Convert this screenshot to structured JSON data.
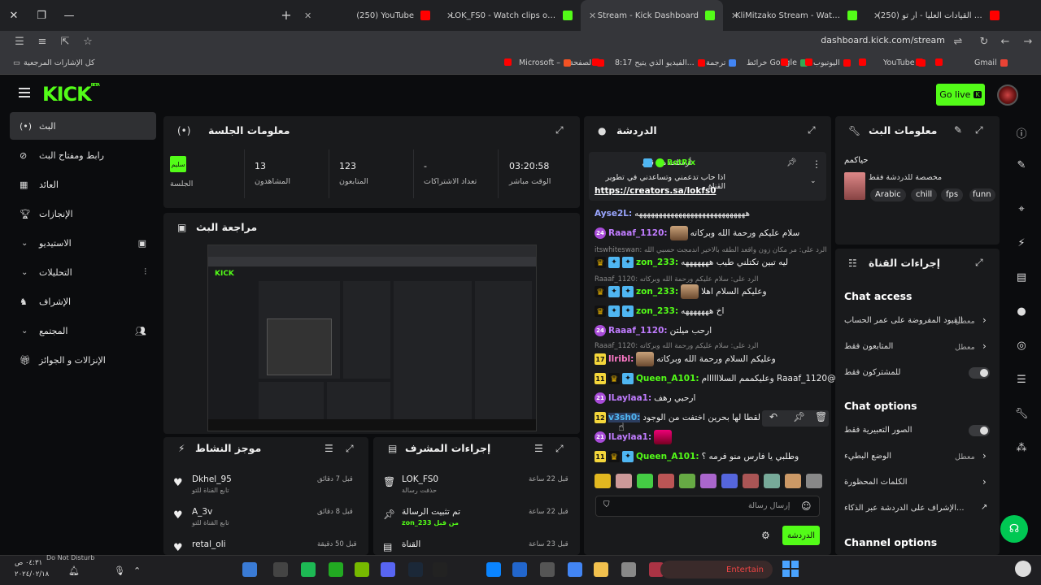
{
  "browser": {
    "tabs": [
      {
        "title": "(250) YouTube",
        "color": "#ff0000",
        "active": false
      },
      {
        "title": "LOK_FS0 - Watch clips on Kick",
        "color": "#53fc18",
        "active": false
      },
      {
        "title": "Stream - Kick Dashboard",
        "color": "#53fc18",
        "active": true
      },
      {
        "title": "KliMitzako Stream - Watch Live",
        "color": "#53fc18",
        "active": false
      },
      {
        "title": "(250) القيادات العليا - أر تو Tube",
        "color": "#ff0000",
        "active": false
      }
    ],
    "url": "dashboard.kick.com/stream",
    "bookmarks_label": "كل الإشارات المرجعية",
    "bookmarks": [
      "Gmail",
      "YouTube",
      "اليوتيوب",
      "خرائط Google",
      "ترجمة",
      "8:17 الفيديو الذي يتيح...",
      "الصفحة",
      "Microsoft –"
    ]
  },
  "header": {
    "logo": "KICK",
    "logo_sup": "BETA",
    "go_live": "Go live"
  },
  "nav": [
    {
      "label": "البث",
      "active": true
    },
    {
      "label": "رابط ومفتاح البث"
    },
    {
      "label": "العائد"
    },
    {
      "label": "الإنجازات"
    },
    {
      "label": "الاستيديو"
    },
    {
      "label": "التحليلات"
    },
    {
      "label": "الإشراف"
    },
    {
      "label": "المجتمع"
    },
    {
      "label": "الإنزالات و الجوائز"
    }
  ],
  "session": {
    "title": "معلومات الجلسة",
    "badge": "سليم",
    "badge_label": "الجلسة",
    "stats": [
      {
        "value": "03:20:58",
        "label": "الوقت مباشر"
      },
      {
        "value": "-",
        "label": "تعداد الاشتراكات"
      },
      {
        "value": "123",
        "label": "المتابعون"
      },
      {
        "value": "13",
        "label": "المشاهدون"
      }
    ]
  },
  "preview": {
    "title": "مراجعة البث"
  },
  "activity": {
    "title": "موجز النشاط",
    "items": [
      {
        "name": "Dkhel_95",
        "sub": "تابع القناة للتو",
        "time": "قبل 7 دقائق"
      },
      {
        "name": "A_3v",
        "sub": "تابع القناة للتو",
        "time": "قبل 8 دقائق"
      },
      {
        "name": "retal_oli",
        "sub": "",
        "time": "قبل 50 دقيقة"
      }
    ]
  },
  "modactions": {
    "title": "إجراءات المشرف",
    "items": [
      {
        "name": "LOK_FS0",
        "sub": "حذفت رسالة",
        "time": "قبل 22 ساعة"
      },
      {
        "name": "تم تثبيت الرسالة",
        "sub": "zon_233 من قبل",
        "time": "قبل 22 ساعة"
      },
      {
        "name": "القناة",
        "sub": "",
        "time": "قبل 23 ساعة"
      }
    ]
  },
  "chat": {
    "title": "الدردشة",
    "pinned_by": "أرسلت من قبل",
    "pinned_user": "BotRix",
    "pinned_msg": "اذا حاب تدعمني وتساعدني في تطوير القناة",
    "pinned_link": "https://creators.sa/lokfs0",
    "messages": [
      {
        "user": "Ayse2L:",
        "color": "#9aa6ff",
        "text": "ههههههههههههههههههههههههههههه",
        "badges": []
      },
      {
        "user": "Raaaf_1120:",
        "color": "#c07cff",
        "text": "سلام عليكم ورحمة الله وبركاته",
        "badges": [
          "24"
        ]
      },
      {
        "reply": "itswhiteswan: الرد على: مر مكان زون واقعد الطقه بالاخير اندمجت حسبي الله"
      },
      {
        "user": "zon_233:",
        "color": "#53fc18",
        "text": "ليه تبين تكتلني طيب هههههههه",
        "badges": [
          "crown",
          "v",
          "v"
        ]
      },
      {
        "reply": "Raaaf_1120: الرد على: سلام عليكم ورحمة الله وبركاته"
      },
      {
        "user": "zon_233:",
        "color": "#53fc18",
        "text": "وعليكم السلام اهلا",
        "badges": [
          "crown",
          "v",
          "v"
        ]
      },
      {
        "user": "zon_233:",
        "color": "#53fc18",
        "text": "اخ هههههههه",
        "badges": [
          "crown",
          "v",
          "v"
        ]
      },
      {
        "user": "Raaaf_1120:",
        "color": "#c07cff",
        "text": "ارحب ميلتن",
        "badges": [
          "24"
        ]
      },
      {
        "reply": "Raaaf_1120: الرد على: سلام عليكم ورحمة الله وبركاته"
      },
      {
        "user": "llribl:",
        "color": "#ff7ac8",
        "text": "وعليكم السلام ورحمة الله وبركاته",
        "badges": [
          "17"
        ]
      },
      {
        "user": "Queen_A101:",
        "color": "#53fc18",
        "text": "@Raaaf_1120 وعليكممم السلاااااام",
        "badges": [
          "11",
          "crown",
          "v"
        ]
      },
      {
        "user": "lLaylaa1:",
        "color": "#c07cff",
        "text": "ارحبي رهف",
        "badges": [
          "21"
        ]
      },
      {
        "user": "v3sh0:",
        "color": "#4fb6f2",
        "text": "آخر لقطا لها بحرين اختفت من الوجود",
        "badges": [
          "12"
        ]
      },
      {
        "user": "lLaylaa1:",
        "color": "#c07cff",
        "text": "",
        "badges": [
          "21"
        ]
      },
      {
        "user": "Queen_A101:",
        "color": "#53fc18",
        "text": "وطلبي يا فارس منو فرمه ؟",
        "badges": [
          "11",
          "crown",
          "v"
        ]
      }
    ],
    "input_placeholder": "إرسال رسالة",
    "send_label": "الدردشة"
  },
  "streaminfo": {
    "title": "معلومات البث",
    "stream_title": "حياكمم",
    "description": "مخصصة للدردشة فقط",
    "tags": [
      "Arabic",
      "chill",
      "fps",
      "funn"
    ]
  },
  "channel": {
    "title": "إجراءات القناة",
    "chat_access": "Chat access",
    "rows1": [
      {
        "label": "القيود المفروضة على عمر الحساب",
        "state": "معطل",
        "type": "chevron"
      },
      {
        "label": "المتابعون فقط",
        "state": "معطل",
        "type": "chevron"
      },
      {
        "label": "للمشتركون فقط",
        "state": "",
        "type": "toggle"
      }
    ],
    "chat_options": "Chat options",
    "rows2": [
      {
        "label": "الصور التعبيرية فقط",
        "state": "",
        "type": "toggle"
      },
      {
        "label": "الوضع البطيء",
        "state": "معطل",
        "type": "chevron"
      },
      {
        "label": "الكلمات المحظورة",
        "state": "",
        "type": "chevron"
      },
      {
        "label": "الإشراف على الدردشة عبر الذكاء...",
        "state": "",
        "type": "ext"
      }
    ],
    "channel_options": "Channel options"
  },
  "taskbar": {
    "time": "٠٤:٣١ ص",
    "date": "٢٠٢٤/٠٢/١٨",
    "dnd": "Do Not Disturb",
    "search_placeholder": "Entertain"
  }
}
